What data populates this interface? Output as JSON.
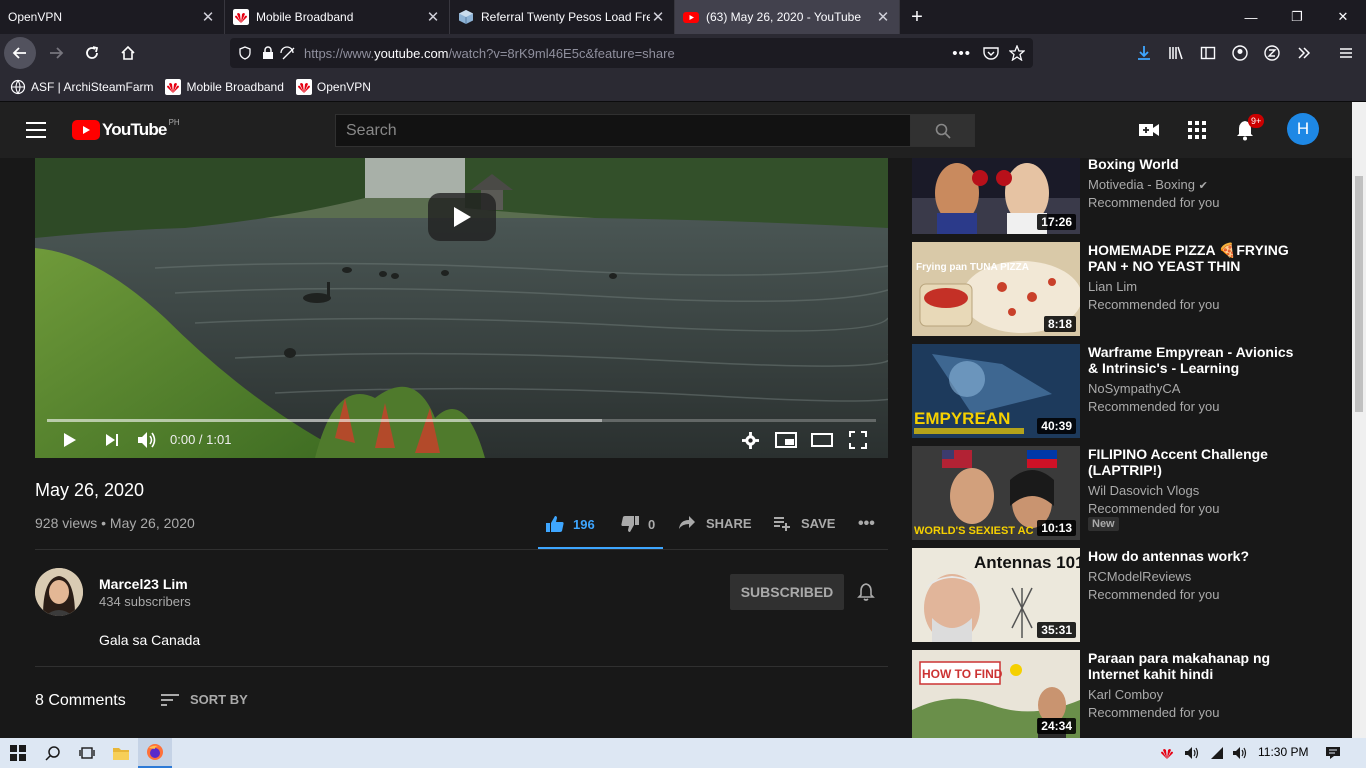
{
  "browser": {
    "tabs": [
      {
        "title": "OpenVPN",
        "active": false
      },
      {
        "title": "Mobile Broadband",
        "active": false
      },
      {
        "title": "Referral Twenty Pesos Load Free",
        "active": false
      },
      {
        "title": "(63) May 26, 2020 - YouTube",
        "active": true
      }
    ],
    "url_prefix": "https://www.",
    "url_domain": "youtube.com",
    "url_suffix": "/watch?v=8rK9ml46E5c&feature=share",
    "bookmarks": [
      "ASF | ArchiSteamFarm",
      "Mobile Broadband",
      "OpenVPN"
    ]
  },
  "youtube": {
    "logo_text": "YouTube",
    "country_code": "PH",
    "search_placeholder": "Search",
    "notification_badge": "9+",
    "avatar_letter": "H"
  },
  "player": {
    "time": "0:00 / 1:01",
    "progress_fraction": 0,
    "buffered_fraction": 0.67
  },
  "video": {
    "title": "May 26, 2020",
    "views_date": "928 views • May 26, 2020",
    "likes": "196",
    "dislikes": "0",
    "share_label": "SHARE",
    "save_label": "SAVE"
  },
  "channel": {
    "name": "Marcel23 Lim",
    "subscribers": "434 subscribers",
    "subscribe_label": "SUBSCRIBED",
    "description": "Gala sa Canada"
  },
  "comments": {
    "count_label": "8 Comments",
    "sort_label": "SORT BY"
  },
  "recommendations": [
    {
      "title": "Boxing World",
      "channel": "Motivedia - Boxing",
      "verified": true,
      "rec": "Recommended for you",
      "duration": "17:26",
      "thumb_text": ""
    },
    {
      "title": "HOMEMADE PIZZA 🍕FRYING PAN + NO YEAST THIN CRUST...",
      "channel": "Lian Lim",
      "verified": false,
      "rec": "Recommended for you",
      "duration": "8:18",
      "thumb_text": "Frying pan TUNA PIZZA"
    },
    {
      "title": "Warframe Empyrean - Avionics & Intrinsic's - Learning Railjack...",
      "channel": "NoSympathyCA",
      "verified": false,
      "rec": "Recommended for you",
      "duration": "40:39",
      "thumb_text": "EMPYREAN"
    },
    {
      "title": "FILIPINO Accent Challenge (LAPTRIP!)",
      "channel": "Wil Dasovich Vlogs",
      "verified": false,
      "rec": "Recommended for you",
      "duration": "10:13",
      "badge": "New",
      "thumb_text": "WORLD'S SEXIEST AC"
    },
    {
      "title": "How do antennas work?",
      "channel": "RCModelReviews",
      "verified": false,
      "rec": "Recommended for you",
      "duration": "35:31",
      "thumb_text": "Antennas 101"
    },
    {
      "title": "Paraan para makahanap ng Internet kahit hindi Serviceabl...",
      "channel": "Karl Comboy",
      "verified": false,
      "rec": "Recommended for you",
      "duration": "24:34",
      "thumb_text": "HOW TO FIND"
    }
  ],
  "taskbar": {
    "clock": "11:30 PM"
  }
}
